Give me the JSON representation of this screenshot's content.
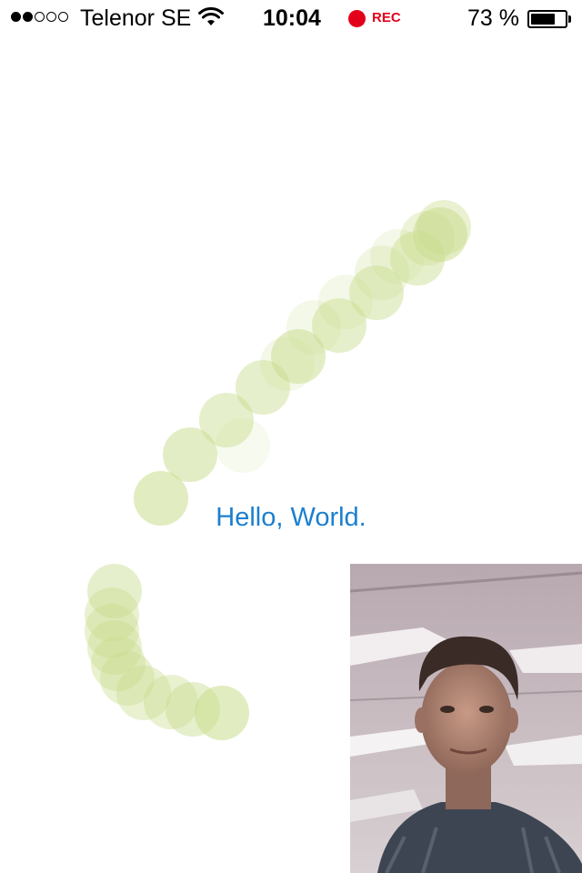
{
  "status_bar": {
    "signal_strength": 2,
    "signal_max": 5,
    "carrier": "Telenor SE",
    "wifi_icon": "wifi-icon",
    "time": "10:04",
    "recording_label": "REC",
    "recording_color": "#e3001b",
    "battery_text": "73 %",
    "battery_level": 0.73
  },
  "main": {
    "greeting": "Hello, World.",
    "greeting_color": "#1b7fcf",
    "trail_color": "#c8dc8c"
  },
  "camera_preview": {
    "icon": "camera-feed"
  }
}
